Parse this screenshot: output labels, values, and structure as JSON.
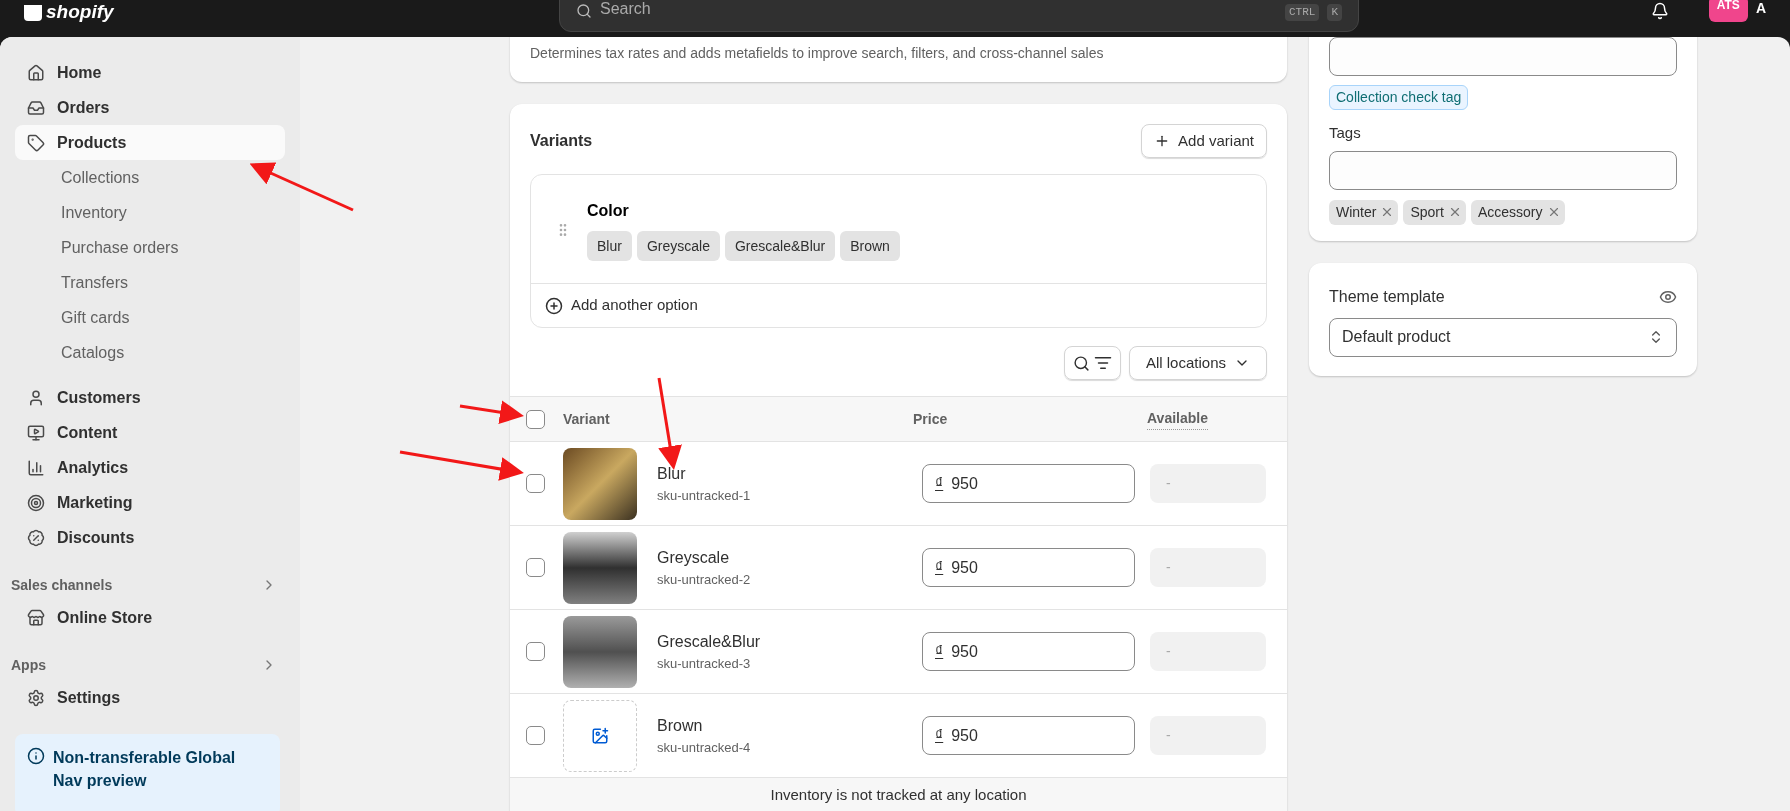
{
  "topbar": {
    "logo": "shopify",
    "search": {
      "placeholder": "Search",
      "keys": [
        "CTRL",
        "K"
      ]
    },
    "avatar": "ATS",
    "account": "A"
  },
  "sidebar": {
    "items": [
      {
        "label": "Home",
        "selected": false
      },
      {
        "label": "Orders",
        "selected": false
      },
      {
        "label": "Products",
        "selected": true,
        "children": [
          {
            "label": "Collections",
            "selected": false
          },
          {
            "label": "Inventory",
            "selected": false
          },
          {
            "label": "Purchase orders",
            "selected": false
          },
          {
            "label": "Transfers",
            "selected": false
          },
          {
            "label": "Gift cards",
            "selected": false
          },
          {
            "label": "Catalogs",
            "selected": false
          }
        ]
      },
      {
        "label": "Customers",
        "selected": false
      },
      {
        "label": "Content",
        "selected": false
      },
      {
        "label": "Analytics",
        "selected": false
      },
      {
        "label": "Marketing",
        "selected": false
      },
      {
        "label": "Discounts",
        "selected": false
      }
    ],
    "sections": [
      {
        "title": "Sales channels",
        "items": [
          {
            "label": "Online Store",
            "selected": false
          }
        ]
      },
      {
        "title": "Apps"
      }
    ],
    "settings": {
      "label": "Settings"
    },
    "banner": "Non-transferable Global Nav preview"
  },
  "category_card": {
    "description": "Determines tax rates and adds metafields to improve search, filters, and cross-channel sales"
  },
  "variants": {
    "title": "Variants",
    "add_button": "Add variant",
    "option": {
      "name": "Color",
      "values": [
        "Blur",
        "Greyscale",
        "Grescale&Blur",
        "Brown"
      ]
    },
    "add_option": "Add another option",
    "location_filter": "All locations",
    "columns": [
      "Variant",
      "Price",
      "Available"
    ],
    "header_checked": false,
    "rows": [
      {
        "name": "Blur",
        "sku": "sku-untracked-1",
        "currency": "₫",
        "price": "950",
        "available": "-",
        "checked": false,
        "kind": "photo"
      },
      {
        "name": "Greyscale",
        "sku": "sku-untracked-2",
        "currency": "₫",
        "price": "950",
        "available": "-",
        "checked": false,
        "kind": "photo"
      },
      {
        "name": "Grescale&Blur",
        "sku": "sku-untracked-3",
        "currency": "₫",
        "price": "950",
        "available": "-",
        "checked": false,
        "kind": "photo"
      },
      {
        "name": "Brown",
        "sku": "sku-untracked-4",
        "currency": "₫",
        "price": "950",
        "available": "-",
        "checked": false,
        "kind": "empty"
      }
    ],
    "footer": "Inventory is not tracked at any location"
  },
  "organization": {
    "collection_tags": [
      "Collection check tag"
    ],
    "tags_label": "Tags",
    "tags": [
      "Winter",
      "Sport",
      "Accessory"
    ]
  },
  "theme": {
    "label": "Theme template",
    "value": "Default product"
  }
}
